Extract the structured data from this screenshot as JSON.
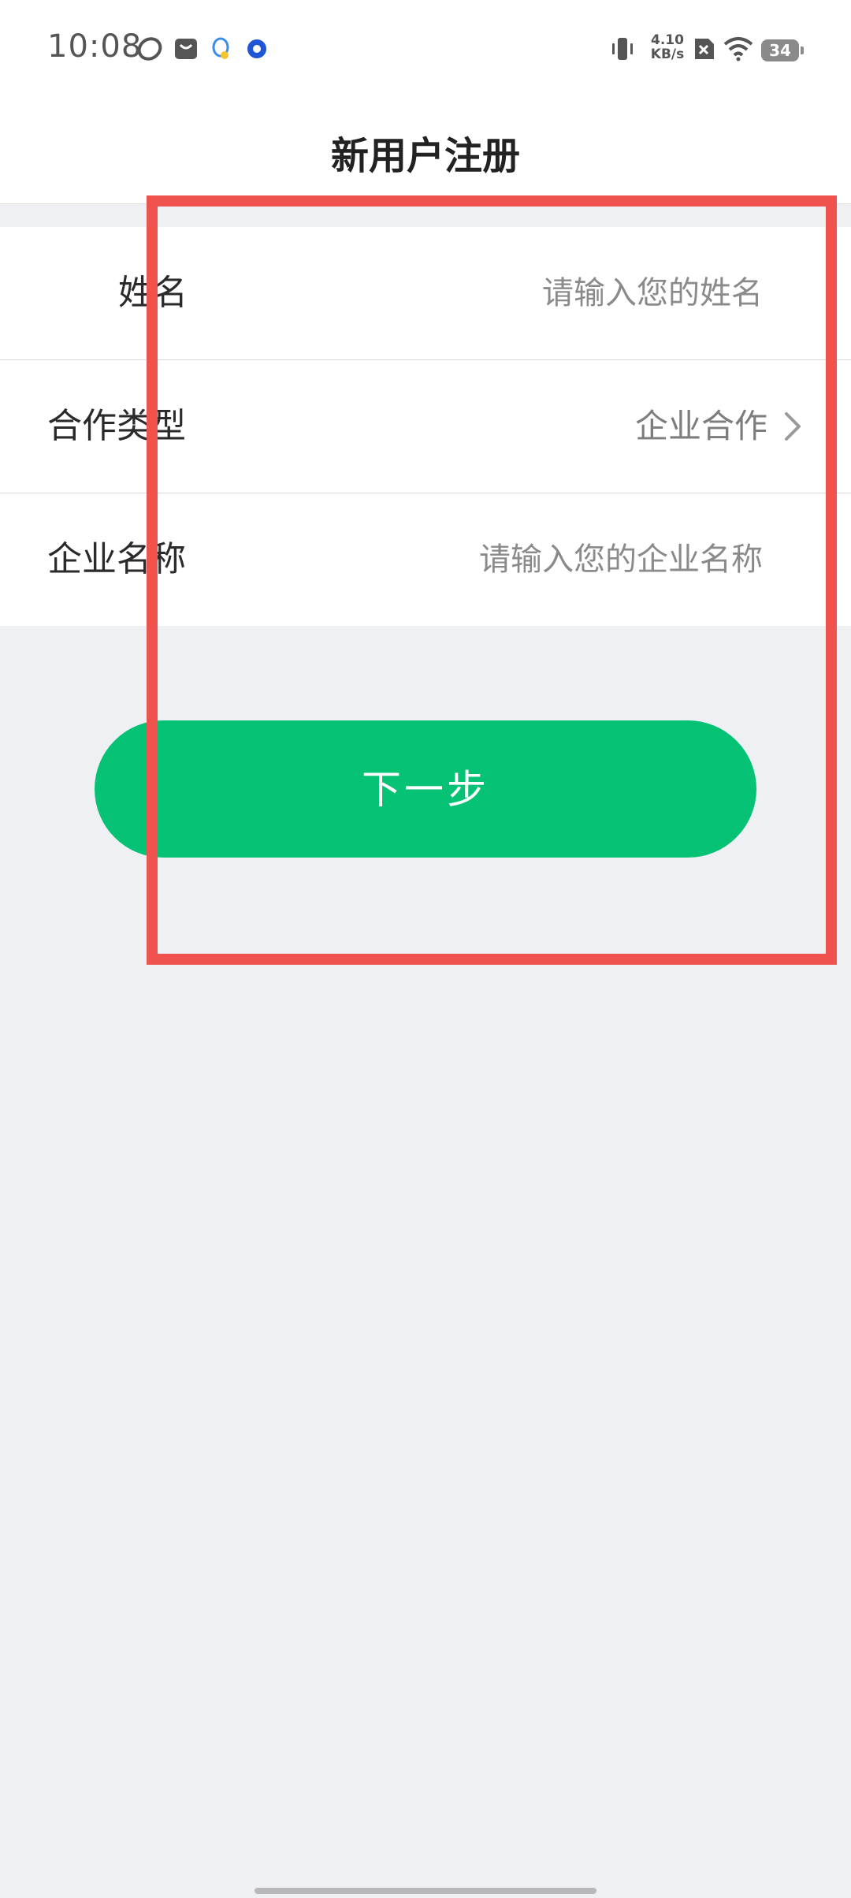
{
  "status_bar": {
    "time": "10:08",
    "net_speed_value": "4.10",
    "net_speed_unit": "KB/s",
    "battery": "34",
    "icons": [
      "app-icon-1",
      "shopping-bag-icon",
      "qq-icon",
      "browser-icon",
      "vibrate-icon",
      "no-sim-icon",
      "wifi-icon",
      "battery-icon"
    ]
  },
  "header": {
    "title": "新用户注册"
  },
  "form": {
    "name": {
      "label": "姓名",
      "placeholder": "请输入您的姓名"
    },
    "cooperation_type": {
      "label": "合作类型",
      "value": "企业合作"
    },
    "company_name": {
      "label": "企业名称",
      "placeholder": "请输入您的企业名称"
    }
  },
  "actions": {
    "next_label": "下一步"
  },
  "colors": {
    "primary_green": "#06c275",
    "background": "#eff0f4",
    "annotation_red": "#f0524e"
  }
}
